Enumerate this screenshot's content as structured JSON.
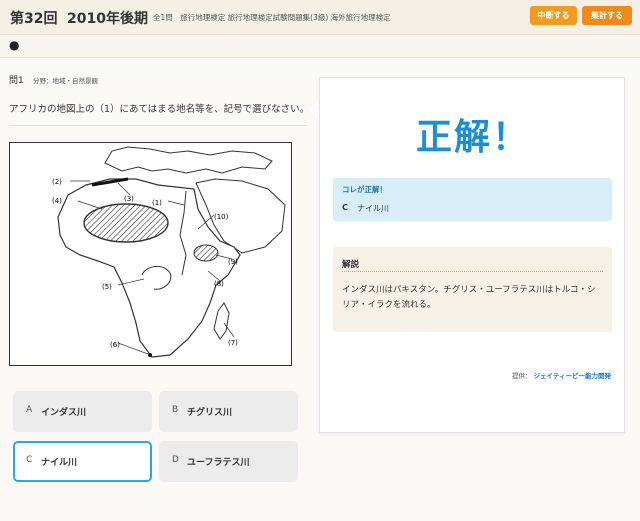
{
  "header": {
    "round": "第32回",
    "period": "2010年後期",
    "meta": "全1問　旅行地理検定 旅行地理検定試験問題集(3級) 海外旅行地理検定",
    "suspend_label": "中断する",
    "score_label": "集計する"
  },
  "subbar": {
    "bullet": "●"
  },
  "question": {
    "number": "問1",
    "field": "分野：地域・自然景観",
    "text": "アフリカの地図上の（1）にあてはまる地名等を、記号で選びなさい。",
    "map_labels": [
      "(1)",
      "(2)",
      "(3)",
      "(4)",
      "(5)",
      "(6)",
      "(7)",
      "(8)",
      "(9)",
      "(10)"
    ]
  },
  "choices": [
    {
      "key": "A",
      "label": "インダス川",
      "selected": false
    },
    {
      "key": "B",
      "label": "チグリス川",
      "selected": false
    },
    {
      "key": "C",
      "label": "ナイル川",
      "selected": true
    },
    {
      "key": "D",
      "label": "ユーフラテス川",
      "selected": false
    }
  ],
  "result": {
    "verdict": "正解！",
    "correct_title": "コレが正解！",
    "correct_key": "C",
    "correct_label": "ナイル川",
    "explanation_title": "解説",
    "explanation_text": "インダス川はパキスタン。チグリス・ユーフラテス川はトルコ・シリア・イラクを流れる。",
    "provider_label": "提供：",
    "provider_name": "ジェイティービー能力開発"
  },
  "colors": {
    "accent": "#1a8fd4",
    "header_bg": "#f4f0e6",
    "button_orange": "#f19b22",
    "correct_bg": "#d7eef9",
    "explanation_bg": "#f5f1e6",
    "selected_border": "#2ea7e0"
  }
}
